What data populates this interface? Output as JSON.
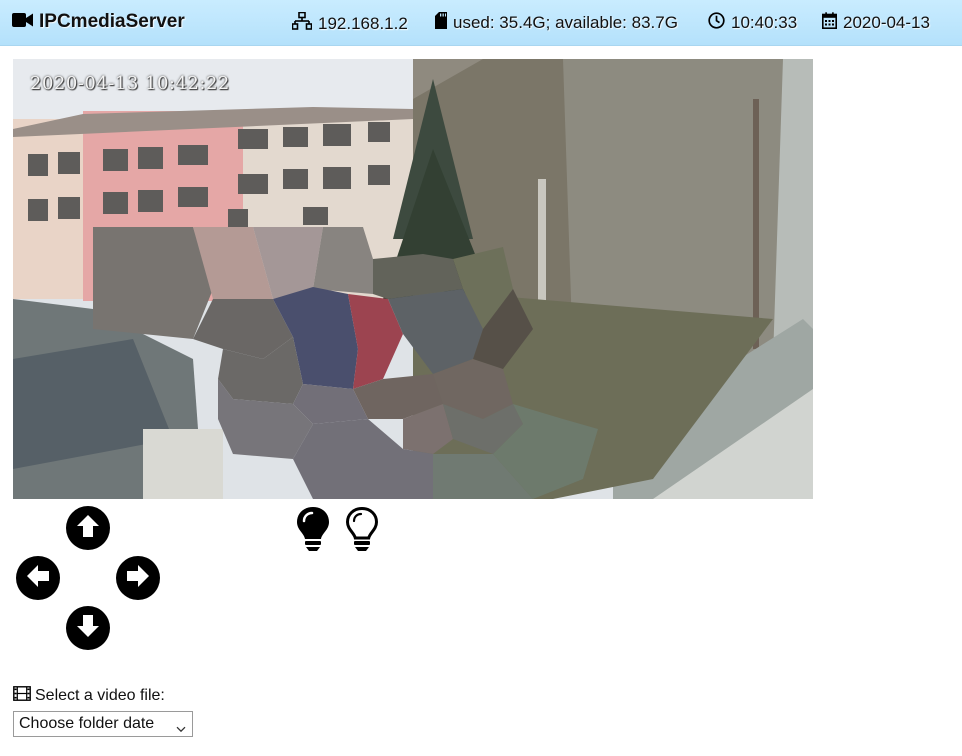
{
  "header": {
    "app_title": "IPCmediaServer",
    "app_icon": "video-camera-icon",
    "ip": {
      "icon": "network-icon",
      "value": "192.168.1.2"
    },
    "storage": {
      "icon": "sd-card-icon",
      "value": "used: 35.4G; available: 83.7G"
    },
    "time": {
      "icon": "clock-icon",
      "value": "10:40:33"
    },
    "date": {
      "icon": "calendar-icon",
      "value": "2020-04-13"
    }
  },
  "video": {
    "timestamp_overlay": "2020-04-13  10:42:22"
  },
  "ptz": {
    "up_icon": "arrow-circle-up-icon",
    "left_icon": "arrow-circle-left-icon",
    "right_icon": "arrow-circle-right-icon",
    "down_icon": "arrow-circle-down-icon"
  },
  "light": {
    "on_icon": "lightbulb-filled-icon",
    "off_icon": "lightbulb-outline-icon"
  },
  "file_select": {
    "icon": "film-icon",
    "label": "Select a video file:",
    "selected": "Choose folder date"
  },
  "colors": {
    "header_bg": "#c0e7fd",
    "icon_color": "#000000"
  }
}
